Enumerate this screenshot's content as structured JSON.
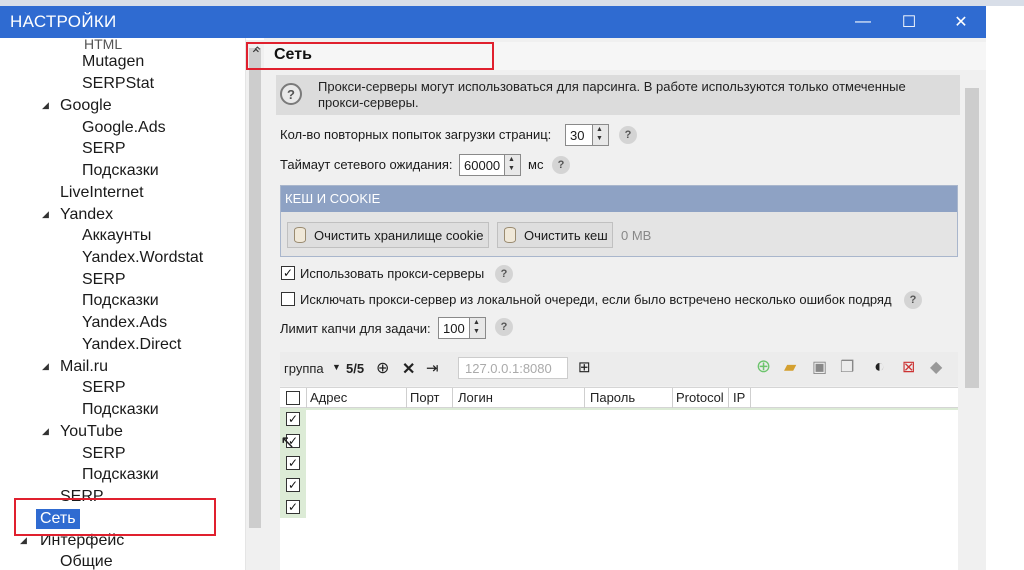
{
  "window": {
    "title": "НАСТРОЙКИ",
    "controls": {
      "minimize": "—",
      "maximize": "☐",
      "close": "✕"
    }
  },
  "tree": {
    "items": [
      {
        "label": "Mutagen"
      },
      {
        "label": "SERPStat"
      },
      {
        "label": "Google"
      },
      {
        "label": "Google.Ads"
      },
      {
        "label": "SERP"
      },
      {
        "label": "Подсказки"
      },
      {
        "label": "LiveInternet"
      },
      {
        "label": "Yandex"
      },
      {
        "label": "Аккаунты"
      },
      {
        "label": "Yandex.Wordstat"
      },
      {
        "label": "SERP"
      },
      {
        "label": "Подсказки"
      },
      {
        "label": "Yandex.Ads"
      },
      {
        "label": "Yandex.Direct"
      },
      {
        "label": "Mail.ru"
      },
      {
        "label": "SERP"
      },
      {
        "label": "Подсказки"
      },
      {
        "label": "YouTube"
      },
      {
        "label": "SERP"
      },
      {
        "label": "Подсказки"
      },
      {
        "label": "SERP"
      },
      {
        "label": "Сеть"
      },
      {
        "label": "Интерфейс"
      },
      {
        "label": "Общие"
      }
    ],
    "selected": "Сеть"
  },
  "section": {
    "title": "Сеть"
  },
  "info": {
    "text": "Прокси-серверы могут использоваться для парсинга. В работе используются только отмеченные прокси-серверы."
  },
  "settings": {
    "retries_label": "Кол-во повторных попыток загрузки страниц:",
    "retries_value": "30",
    "timeout_label": "Таймаут сетевого ожидания:",
    "timeout_value": "60000",
    "timeout_unit": "мс",
    "help": "?"
  },
  "cache": {
    "header": "КЕШ И COOKIE",
    "clear_cookie": "Очистить хранилище cookie",
    "clear_cache": "Очистить кеш",
    "size": "0 MB"
  },
  "proxy": {
    "use_label": "Использовать прокси-серверы",
    "use_checked": true,
    "exclude_label": "Исключать прокси-сервер из локальной очереди, если было встречено несколько ошибок подряд",
    "exclude_checked": false,
    "captcha_label": "Лимит капчи для задачи:",
    "captcha_value": "100"
  },
  "grid": {
    "group_select": "группа",
    "count": "5/5",
    "address_placeholder": "127.0.0.1:8080",
    "columns": [
      "Адрес",
      "Порт",
      "Логин",
      "Пароль",
      "Protocol",
      "IP"
    ],
    "rows_checked": [
      true,
      true,
      true,
      true,
      true
    ]
  },
  "colors": {
    "titlebar": "#2f6bd1",
    "highlight": "#e0202e",
    "cache_header": "#8ea2c4"
  }
}
